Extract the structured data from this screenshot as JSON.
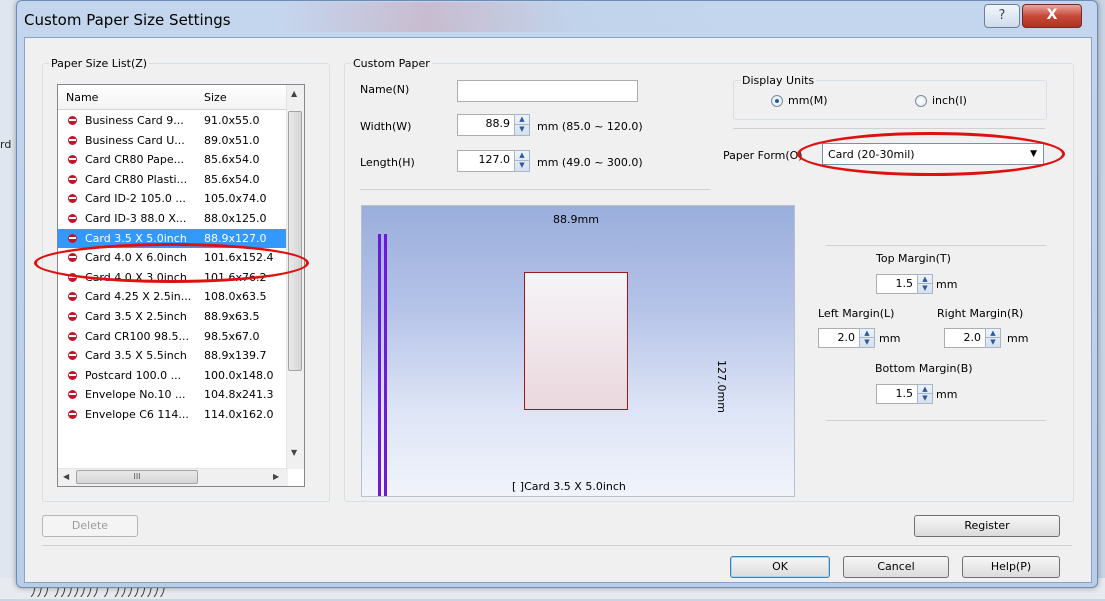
{
  "background": {
    "left_text": "rd",
    "bottom_text": "ﾉﾉﾉ ﾉﾉﾉﾉﾉﾉﾉ ﾉ ﾉﾉﾉﾉﾉﾉﾉﾉ"
  },
  "window": {
    "title": "Custom Paper Size Settings",
    "help_glyph": "?",
    "close_glyph": "X"
  },
  "paper_list": {
    "group_label": "Paper Size List(Z)",
    "columns": {
      "name": "Name",
      "size": "Size"
    },
    "items": [
      {
        "name": "Business Card 9...",
        "size": "91.0x55.0"
      },
      {
        "name": "Business Card U...",
        "size": "89.0x51.0"
      },
      {
        "name": "Card CR80 Pape...",
        "size": "85.6x54.0"
      },
      {
        "name": "Card CR80 Plasti...",
        "size": "85.6x54.0"
      },
      {
        "name": "Card ID-2 105.0 ...",
        "size": "105.0x74.0"
      },
      {
        "name": "Card ID-3 88.0 X...",
        "size": "88.0x125.0"
      },
      {
        "name": "Card 3.5 X 5.0inch",
        "size": "88.9x127.0"
      },
      {
        "name": "Card 4.0 X 6.0inch",
        "size": "101.6x152.4"
      },
      {
        "name": "Card 4.0 X 3.0inch",
        "size": "101.6x76.2"
      },
      {
        "name": "Card 4.25 X 2.5in...",
        "size": "108.0x63.5"
      },
      {
        "name": "Card 3.5 X 2.5inch",
        "size": "88.9x63.5"
      },
      {
        "name": "Card CR100 98.5...",
        "size": "98.5x67.0"
      },
      {
        "name": "Card 3.5 X 5.5inch",
        "size": "88.9x139.7"
      },
      {
        "name": "Postcard 100.0 ...",
        "size": "100.0x148.0"
      },
      {
        "name": "Envelope No.10 ...",
        "size": "104.8x241.3"
      },
      {
        "name": "Envelope C6 114...",
        "size": "114.0x162.0"
      }
    ],
    "selected_index": 6,
    "scroll_thumb_glyph": "III"
  },
  "custom_paper": {
    "group_label": "Custom Paper",
    "name_label": "Name(N)",
    "name_value": "",
    "width_label": "Width(W)",
    "width_value": "88.9",
    "width_range": "mm (85.0 ~ 120.0)",
    "length_label": "Length(H)",
    "length_value": "127.0",
    "length_range": "mm (49.0 ~ 300.0)"
  },
  "display_units": {
    "group_label": "Display Units",
    "options": [
      "mm(M)",
      "inch(I)"
    ],
    "selected": "mm(M)"
  },
  "paper_form": {
    "label": "Paper Form(O)",
    "value": "Card (20-30mil)"
  },
  "preview": {
    "width_label": "88.9mm",
    "length_label": "127.0mm",
    "caption": "[ ]Card 3.5 X 5.0inch"
  },
  "margins": {
    "top_label": "Top Margin(T)",
    "top_value": "1.5",
    "left_label": "Left Margin(L)",
    "left_value": "2.0",
    "right_label": "Right Margin(R)",
    "right_value": "2.0",
    "bottom_label": "Bottom Margin(B)",
    "bottom_value": "1.5",
    "unit": "mm"
  },
  "buttons": {
    "delete": "Delete",
    "register": "Register",
    "ok": "OK",
    "cancel": "Cancel",
    "help": "Help(P)"
  },
  "colors": {
    "highlight_circle": "#e01010",
    "selection": "#3399ff",
    "preview_arrow": "#6b1bd8"
  }
}
